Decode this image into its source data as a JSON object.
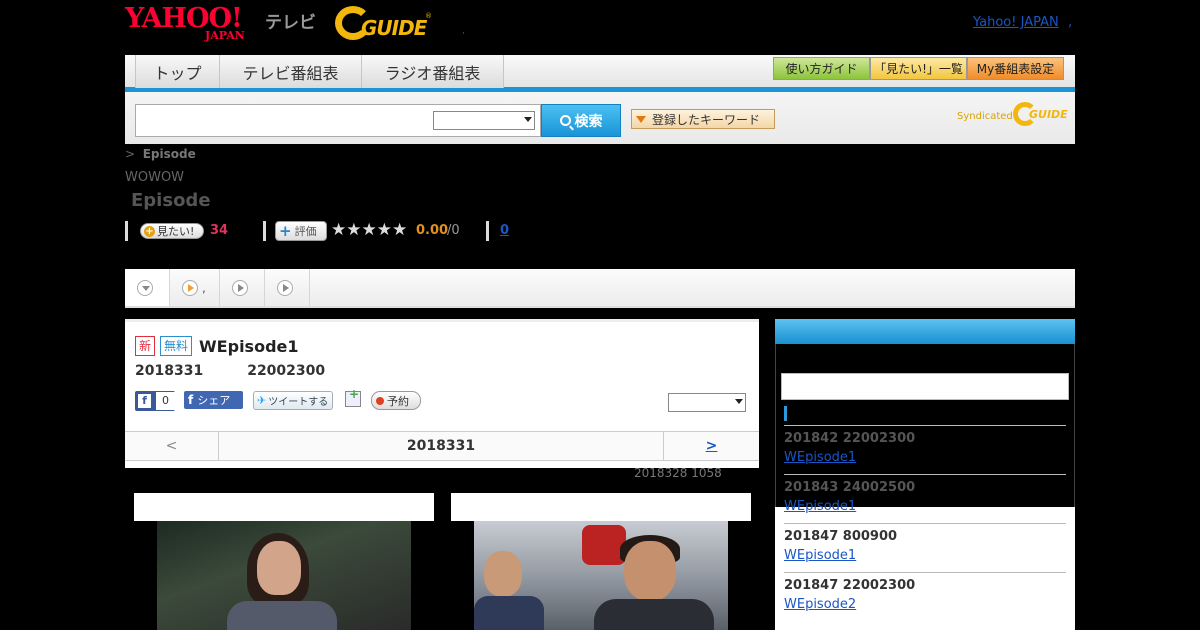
{
  "header": {
    "yahoo_logo": "YAHOO!",
    "yahoo_logo_sub": "JAPAN",
    "tv_label": "テレビ",
    "gguide_logo": "GUIDE",
    "gguide_reg": "®",
    "dot": ",",
    "yahoo_japan_link": "Yahoo! JAPAN",
    "trailing_comma": ","
  },
  "nav": {
    "tabs": [
      {
        "label": "トップ"
      },
      {
        "label": "テレビ番組表"
      },
      {
        "label": "ラジオ番組表"
      }
    ],
    "buttons": [
      {
        "label": "使い方ガイド"
      },
      {
        "label": "「見たい!」一覧"
      },
      {
        "label": "My番組表設定"
      }
    ]
  },
  "search": {
    "placeholder": "",
    "button_label": "検索",
    "keyword_button_label": "登録したキーワード",
    "syndicated_label": "Syndicated",
    "syndicated_logo": "GUIDE"
  },
  "program": {
    "breadcrumb_sep": ">",
    "breadcrumb_current": "Episode",
    "channel": "WOWOW",
    "title": "Episode",
    "mitai_label": "見たい!",
    "mitai_count": "34",
    "hyoka_label": "評価",
    "stars": "★★★★★",
    "rating": "0.00",
    "rating_max": "/0",
    "comment_count": "0"
  },
  "subtabs": [
    {
      "label": ""
    },
    {
      "label": ","
    },
    {
      "label": ""
    },
    {
      "label": ""
    }
  ],
  "episode": {
    "badge_new": "新",
    "badge_free": "無料",
    "title": "WEpisode1",
    "date": "2018331",
    "time": "22002300",
    "fb_like_count": "0",
    "fb_share_label": "シェア",
    "tweet_label": "ツイートする",
    "reserve_label": "予約",
    "nav_prev": "<",
    "nav_date": "2018331",
    "nav_next": ">",
    "updated": "2018328  1058"
  },
  "sidebar": {
    "items": [
      {
        "datetime": "201842  22002300",
        "link": "WEpisode1"
      },
      {
        "datetime": "201843  24002500",
        "link": "WEpisode1"
      },
      {
        "datetime": "201847  800900",
        "link": "WEpisode1"
      },
      {
        "datetime": "201847  22002300",
        "link": "WEpisode2"
      }
    ]
  },
  "colors": {
    "accent_blue": "#1d95d4",
    "yahoo_red": "#ff0033",
    "gguide_yellow": "#f2b60c",
    "mitai_pink": "#e0325a",
    "rating_orange": "#e09020"
  }
}
